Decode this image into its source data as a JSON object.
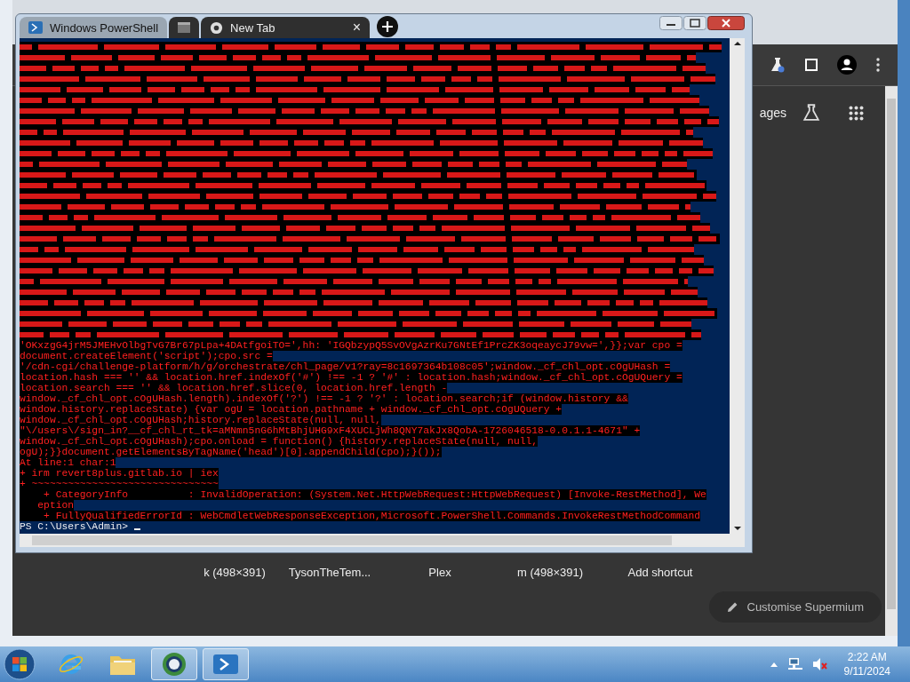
{
  "browser": {
    "search_links": [
      {
        "label": "ages"
      }
    ],
    "shortcuts": [
      {
        "label": "k (498×391)"
      },
      {
        "label": "TysonTheTem..."
      },
      {
        "label": "Plex"
      },
      {
        "label": "m (498×391)"
      },
      {
        "label": "Add shortcut"
      }
    ],
    "customise_button": "Customise Supermium"
  },
  "powershell": {
    "tabs": [
      {
        "kind": "text",
        "label": "Windows PowerShell",
        "selected": true
      },
      {
        "kind": "icon",
        "selected": false
      },
      {
        "kind": "text",
        "label": "New Tab",
        "selected": false,
        "close": "×"
      }
    ],
    "console": {
      "lines": [
        "'OKxzgG4jrM5JMEHvOlbgTvG7Br67pLpa+4DAtfgoiTO=',hh: 'IGQbzypQ5SvOVgAzrKu7GNtEf1PrcZK3oqeaycJ79vw=',}};var cpo =",
        "document.createElement('script');cpo.src =",
        "'/cdn-cgi/challenge-platform/h/g/orchestrate/chl_page/v1?ray=8c1697364b108c05';window._cf_chl_opt.cOgUHash =",
        "location.hash === '' && location.href.indexOf('#') !== -1 ? '#' : location.hash;window._cf_chl_opt.cOgUQuery =",
        "location.search === '' && location.href.slice(0, location.href.length -",
        "window._cf_chl_opt.cOgUHash.length).indexOf('?') !== -1 ? '?' : location.search;if (window.history &&",
        "window.history.replaceState) {var ogU = location.pathname + window._cf_chl_opt.cOgUQuery +",
        "window._cf_chl_opt.cOgUHash;history.replaceState(null, null,",
        "\"\\/users\\/sign_in?__cf_chl_rt_tk=aMNmn5nG6hMtBhjUHG9xF4XUCLjWh8QNY7akJx8QobA-1726046518-0.0.1.1-4671\" +",
        "window._cf_chl_opt.cOgUHash);cpo.onload = function() {history.replaceState(null, null,",
        "ogU);}}document.getElementsByTagName('head')[0].appendChild(cpo);}());",
        "At line:1 char:1",
        "+ irm revert8plus.gitlab.io | iex",
        "+ ~~~~~~~~~~~~~~~~~~~~~~~~~~~~~~~",
        "    + CategoryInfo          : InvalidOperation: (System.Net.HttpWebRequest:HttpWebRequest) [Invoke-RestMethod], We",
        "   eption",
        "    + FullyQualifiedErrorId : WebCmdletWebResponseException,Microsoft.PowerShell.Commands.InvokeRestMethodCommand"
      ],
      "prompt": "PS C:\\Users\\Admin>"
    }
  },
  "taskbar": {
    "items": [
      {
        "kind": "ie",
        "selected": false
      },
      {
        "kind": "folder",
        "selected": false
      },
      {
        "kind": "browser",
        "selected": true
      },
      {
        "kind": "powershell",
        "selected": true
      }
    ],
    "time": "2:22 AM",
    "date": "9/11/2024"
  }
}
